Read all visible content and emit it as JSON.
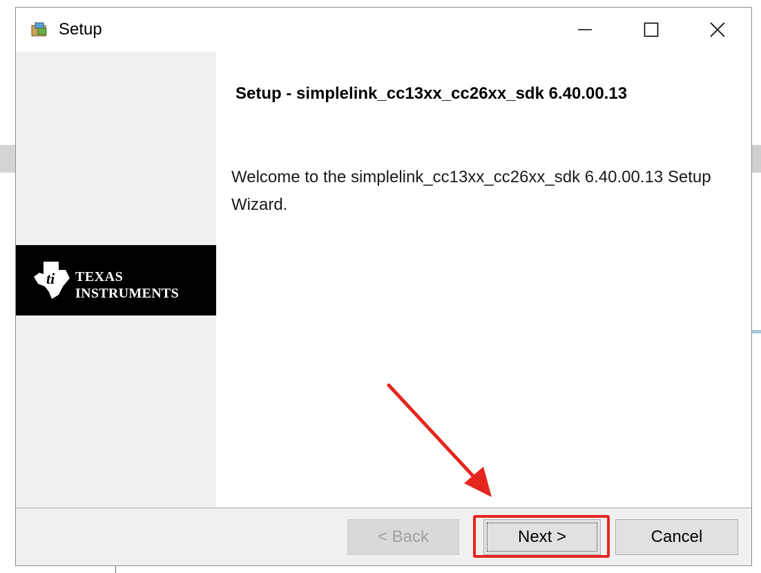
{
  "window": {
    "title": "Setup",
    "controls": {
      "minimize": "minimize",
      "maximize": "maximize",
      "close": "close"
    }
  },
  "branding": {
    "line1": "Texas",
    "line2": "Instruments"
  },
  "content": {
    "heading": "Setup - simplelink_cc13xx_cc26xx_sdk 6.40.00.13",
    "welcome": "Welcome to the simplelink_cc13xx_cc26xx_sdk 6.40.00.13 Setup Wizard."
  },
  "buttons": {
    "back": "< Back",
    "next": "Next >",
    "cancel": "Cancel"
  },
  "annotation": {
    "color": "#e5261e"
  },
  "icons": [
    "setup-app-icon",
    "minimize-icon",
    "maximize-icon",
    "close-icon",
    "ti-logo-icon"
  ]
}
